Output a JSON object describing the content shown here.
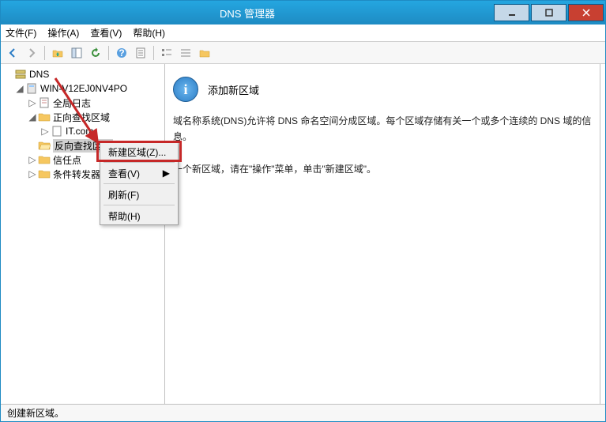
{
  "window": {
    "title": "DNS 管理器"
  },
  "menubar": {
    "file": "文件(F)",
    "action": "操作(A)",
    "view": "查看(V)",
    "help": "帮助(H)"
  },
  "tree": {
    "root": "DNS",
    "server": "WIN-V12EJ0NV4PO",
    "global_log": "全局日志",
    "forward": "正向查找区域",
    "forward_child": "IT.com",
    "reverse": "反向查找区域",
    "trust": "信任点",
    "cond": "条件转发器"
  },
  "context_menu": {
    "new_zone": "新建区域(Z)...",
    "view": "查看(V)",
    "refresh": "刷新(F)",
    "help": "帮助(H)"
  },
  "content": {
    "heading": "添加新区域",
    "p1": "域名称系统(DNS)允许将 DNS 命名空间分成区域。每个区域存储有关一个或多个连续的 DNS 域的信息。",
    "p2_suffix": "一个新区域，请在\"操作\"菜单，单击\"新建区域\"。"
  },
  "status": {
    "text": "创建新区域。"
  }
}
